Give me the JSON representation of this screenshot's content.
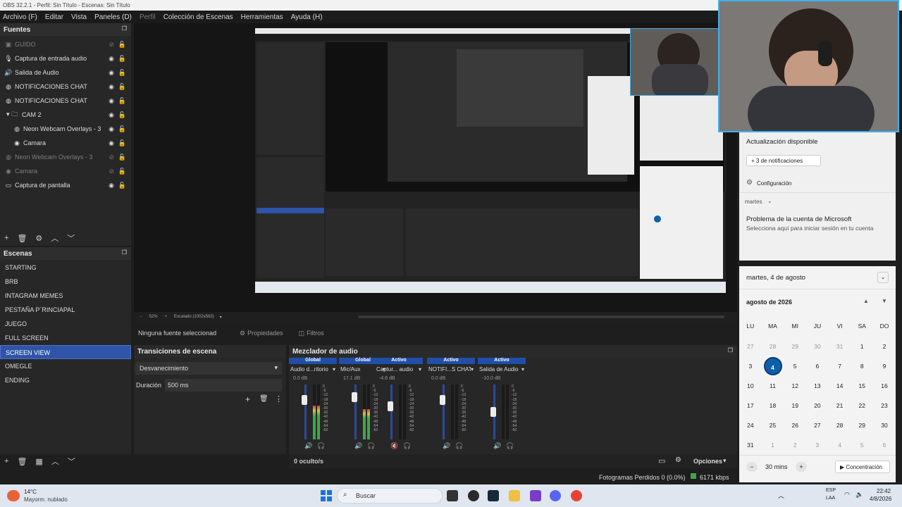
{
  "window": {
    "title": "OBS 32.2.1 - Perfil: Sin Título - Escenas: Sin Título"
  },
  "menu": [
    "Archivo (F)",
    "Editar",
    "Vista",
    "Paneles (D)",
    "Perfil",
    "Colección de Escenas",
    "Herramientas",
    "Ayuda (H)"
  ],
  "sources": {
    "title": "Fuentes",
    "items": [
      {
        "label": "GUIDO",
        "icon": "scene-icon",
        "dim": true
      },
      {
        "label": "Captura de entrada audio",
        "icon": "mic-icon",
        "dim": false
      },
      {
        "label": "Salida de Audio",
        "icon": "speaker-icon",
        "dim": false
      },
      {
        "label": "NOTIFICACIONES CHAT",
        "icon": "browser-icon",
        "dim": false
      },
      {
        "label": "NOTIFICACIONES CHAT",
        "icon": "browser-icon",
        "dim": false
      },
      {
        "label": "CAM 2",
        "icon": "folder-icon",
        "dim": false
      },
      {
        "label": "Neon Webcam Overlays - 3",
        "icon": "browser-icon",
        "dim": false
      },
      {
        "label": "Camara",
        "icon": "camera-icon",
        "dim": false
      },
      {
        "label": "Neon Webcam Overlays - 3",
        "icon": "browser-icon",
        "dim": true
      },
      {
        "label": "Camara",
        "icon": "camera-icon",
        "dim": true
      },
      {
        "label": "Captura de pantalla",
        "icon": "monitor-icon",
        "dim": false
      }
    ]
  },
  "scenes": {
    "title": "Escenas",
    "items": [
      "STARTING",
      "BRB",
      "INTAGRAM MEMES",
      "PESTAÑA P´RINCIAPAL",
      "JUEGO",
      "FULL SCREEN",
      "SCREEN VIEW",
      "OMEGLE",
      "ENDING"
    ],
    "selected": "SCREEN VIEW"
  },
  "preview": {
    "zoom": "52%",
    "scale_label": "Escalado (1002x563)"
  },
  "context": {
    "no_source": "Ninguna fuente seleccionad",
    "properties": "Propiedades",
    "filters": "Filtros"
  },
  "transitions": {
    "title": "Transiciones de escena",
    "selected": "Desvanecimiento",
    "duration_label": "Duración",
    "duration_value": "500 ms"
  },
  "mixer": {
    "title": "Mezclador de audio",
    "hidden": "0 oculto/s",
    "channels": [
      {
        "tag": "Global",
        "name": "Audio d...ritorio",
        "db": "0.0 dB",
        "level": 0.62,
        "fader": 0.78,
        "muted": false
      },
      {
        "tag": "Global",
        "name": "Mic/Aux",
        "db": "17.1 dB",
        "level": 0.55,
        "fader": 0.85,
        "muted": false
      },
      {
        "tag": "Activo",
        "name": "Captur... audio",
        "db": "-4.6 dB",
        "level": 0.0,
        "fader": 0.66,
        "muted": true
      },
      {
        "tag": "Activo",
        "name": "NOTIFI...S CHAT",
        "db": "0.0 dB",
        "level": 0.0,
        "fader": 0.78,
        "muted": false
      },
      {
        "tag": "Activo",
        "name": "Salida de Audio",
        "db": "-10.0 dB",
        "level": 0.0,
        "fader": 0.55,
        "muted": false
      }
    ],
    "scale": [
      "0",
      "-6",
      "-12",
      "-18",
      "-24",
      "-30",
      "-36",
      "-42",
      "-48",
      "-54",
      "-60"
    ],
    "options": "Opciones"
  },
  "status": {
    "dropped": "Fotogramas Perdidos 0 (0.0%)",
    "bitrate": "6171 kbps"
  },
  "notification": {
    "update": "Actualización disponible",
    "more": "+ 3 de notificaciones",
    "config": "Configuración",
    "day": "martes",
    "ms_title": "Problema de la cuenta de Microsoft",
    "ms_body": "Selecciona aquí para iniciar sesión en tu cuenta"
  },
  "calendar": {
    "header": "martes, 4 de agosto",
    "month": "agosto de 2026",
    "weekdays": [
      "LU",
      "MA",
      "MI",
      "JU",
      "VI",
      "SA",
      "DO"
    ],
    "weeks": [
      [
        [
          "27",
          1
        ],
        [
          "28",
          1
        ],
        [
          "29",
          1
        ],
        [
          "30",
          1
        ],
        [
          "31",
          1
        ],
        [
          "1",
          0
        ],
        [
          "2",
          0
        ]
      ],
      [
        [
          "3",
          0
        ],
        [
          "4",
          2
        ],
        [
          "5",
          0
        ],
        [
          "6",
          0
        ],
        [
          "7",
          0
        ],
        [
          "8",
          0
        ],
        [
          "9",
          0
        ]
      ],
      [
        [
          "10",
          0
        ],
        [
          "11",
          0
        ],
        [
          "12",
          0
        ],
        [
          "13",
          0
        ],
        [
          "14",
          0
        ],
        [
          "15",
          0
        ],
        [
          "16",
          0
        ]
      ],
      [
        [
          "17",
          0
        ],
        [
          "18",
          0
        ],
        [
          "19",
          0
        ],
        [
          "20",
          0
        ],
        [
          "21",
          0
        ],
        [
          "22",
          0
        ],
        [
          "23",
          0
        ]
      ],
      [
        [
          "24",
          0
        ],
        [
          "25",
          0
        ],
        [
          "26",
          0
        ],
        [
          "27",
          0
        ],
        [
          "28",
          0
        ],
        [
          "29",
          0
        ],
        [
          "30",
          0
        ]
      ],
      [
        [
          "31",
          0
        ],
        [
          "1",
          1
        ],
        [
          "2",
          1
        ],
        [
          "3",
          1
        ],
        [
          "4",
          1
        ],
        [
          "5",
          1
        ],
        [
          "6",
          1
        ]
      ]
    ],
    "focus_time": "30 mins",
    "focus_button": "Concentración"
  },
  "taskbar": {
    "weather_temp": "14°C",
    "weather_desc": "Mayorm. nublado",
    "search": "Buscar",
    "lang1": "ESP",
    "lang2": "LAA",
    "time": "22:42",
    "date": "4/8/2026"
  },
  "colors": {
    "accent": "#2f54a8",
    "calendar_today": "#0f5fa8",
    "webcam_border": "#3fb0e8"
  }
}
